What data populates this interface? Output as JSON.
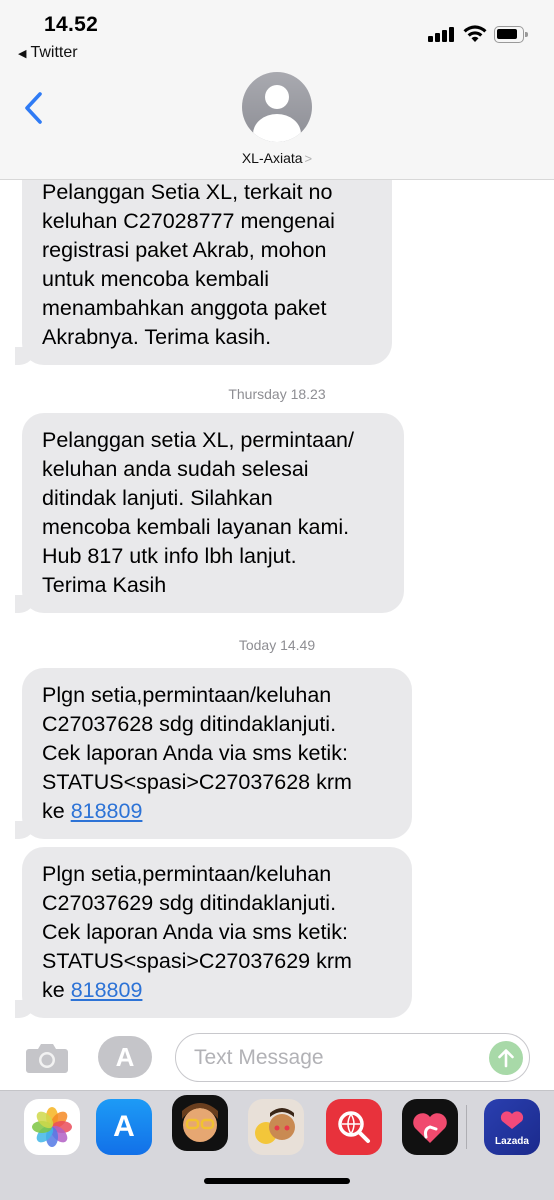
{
  "status_bar": {
    "time": "14.52",
    "back_app": "Twitter"
  },
  "header": {
    "contact_name": "XL-Axiata",
    "icons": [
      "back-chevron-icon",
      "contact-avatar-icon",
      "chevron-right-icon"
    ]
  },
  "messages": [
    {
      "lines": [
        "Pelanggan Setia XL, terkait no",
        "keluhan C27028777 mengenai",
        "registrasi paket Akrab, mohon",
        "untuk mencoba kembali",
        "menambahkan anggota paket",
        "Akrabnya. Terima kasih."
      ]
    },
    {
      "timestamp": "Thursday 18.23"
    },
    {
      "lines": [
        "Pelanggan setia XL, permintaan/",
        "keluhan anda sudah selesai",
        "ditindak lanjuti. Silahkan",
        "mencoba kembali layanan kami.",
        "Hub 817 utk info lbh lanjut.",
        "Terima Kasih"
      ]
    },
    {
      "timestamp": "Today 14.49"
    },
    {
      "lines": [
        "Plgn setia,permintaan/keluhan",
        "C27037628 sdg ditindaklanjuti.",
        "Cek laporan Anda via sms ketik:",
        "STATUS<spasi>C27037628 krm"
      ],
      "last_prefix": "ke ",
      "link": "818809"
    },
    {
      "lines": [
        "Plgn setia,permintaan/keluhan",
        "C27037629 sdg ditindaklanjuti.",
        "Cek laporan Anda via sms ketik:",
        "STATUS<spasi>C27037629 krm"
      ],
      "last_prefix": "ke ",
      "link": "818809"
    }
  ],
  "input_bar": {
    "placeholder": "Text Message",
    "value": ""
  },
  "app_drawer": {
    "apps": [
      "Photos",
      "App Store",
      "Memoji",
      "Memoji Stickers",
      "Search",
      "Digital Touch",
      "Lazada"
    ],
    "lazada_label": "Lazada"
  },
  "colors": {
    "bubble": "#e9e9eb",
    "link": "#2d73d6",
    "timestamp": "#8e8e93",
    "send_button": "#a8d9a8",
    "back_chevron": "#2f7bf5"
  }
}
